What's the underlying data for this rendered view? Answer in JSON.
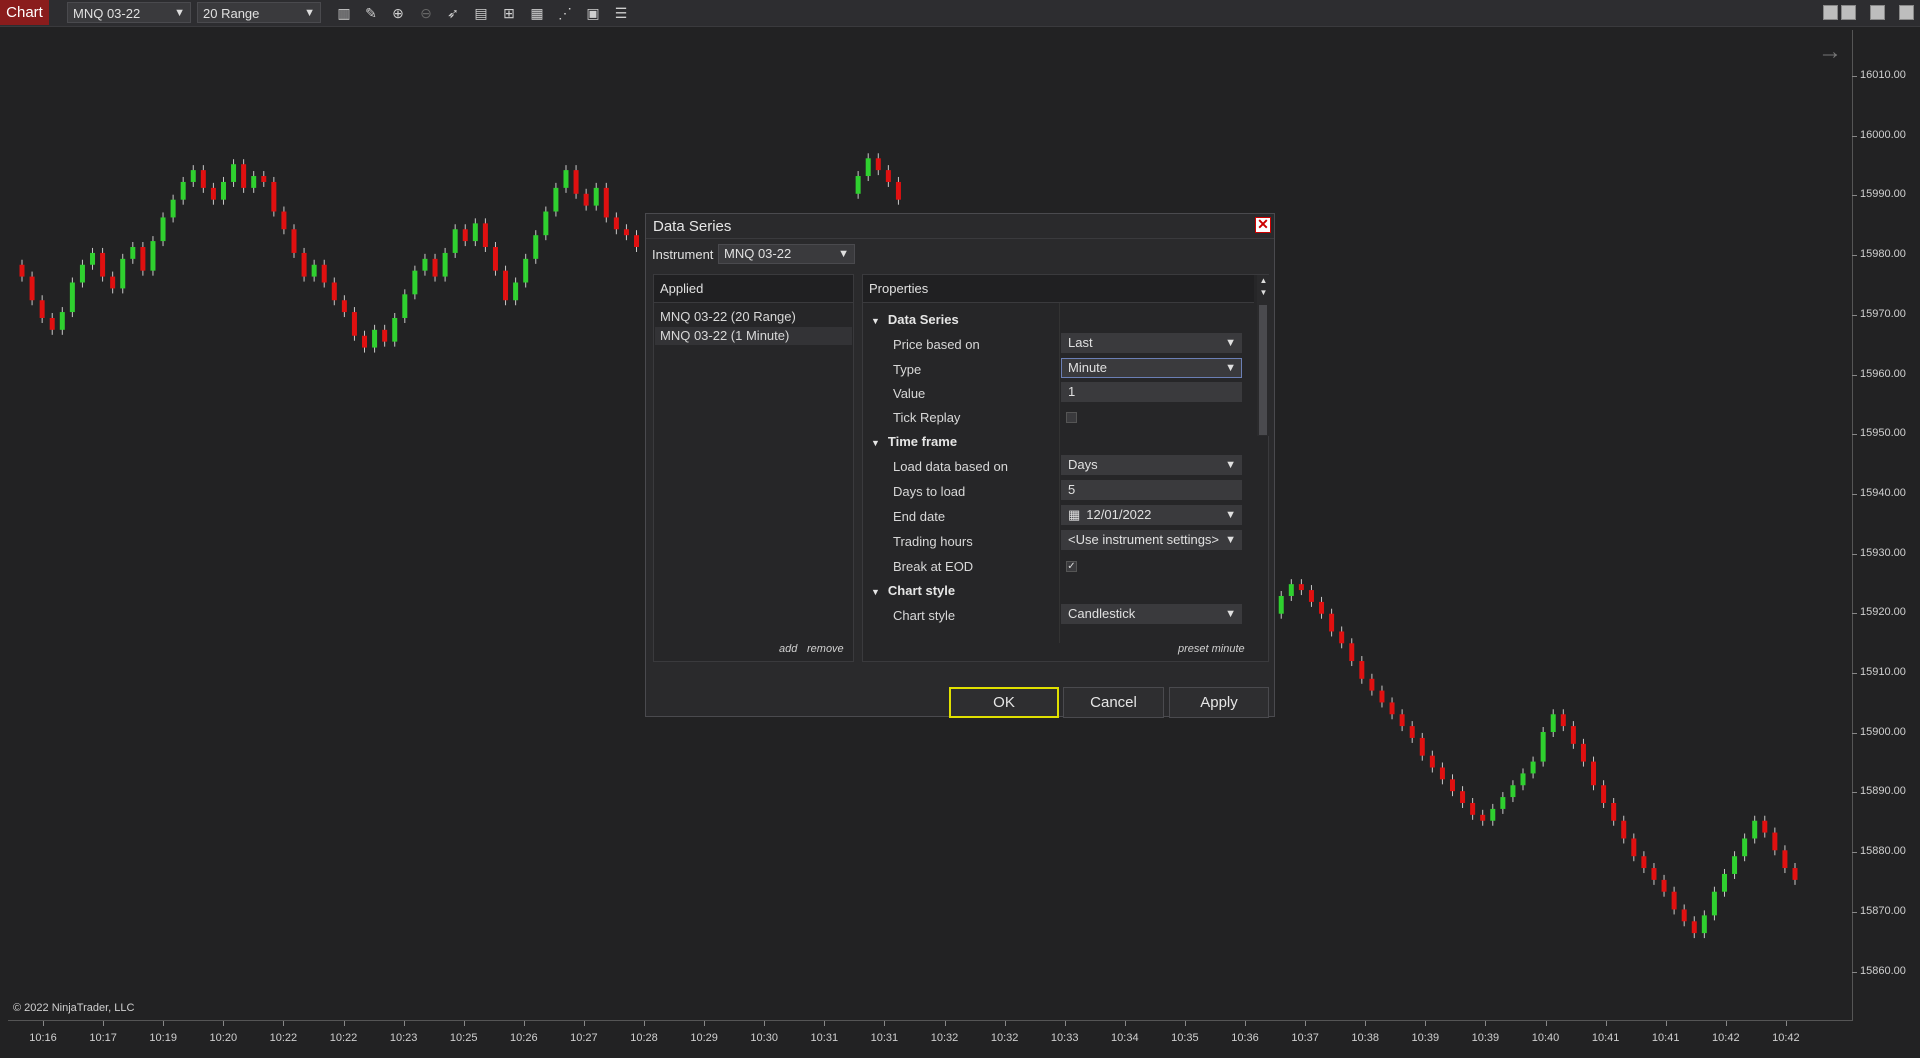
{
  "toolbar": {
    "chart_tab": "Chart",
    "instrument": "MNQ 03-22",
    "interval": "20 Range",
    "icons": [
      "bar-type-icon",
      "pencil-icon",
      "zoom-in-icon",
      "zoom-out-icon",
      "pointer-icon",
      "data-series-icon",
      "chart-style-icon",
      "indicators-icon",
      "strategies-icon",
      "templates-icon",
      "properties-icon"
    ]
  },
  "window_buttons": [
    "tile-icon",
    "minimize-icon",
    "maximize-icon",
    "close-icon"
  ],
  "chart": {
    "copyright": "© 2022 NinjaTrader, LLC",
    "y_labels": [
      "16010.00",
      "16000.00",
      "15990.00",
      "15980.00",
      "15970.00",
      "15960.00",
      "15950.00",
      "15940.00",
      "15930.00",
      "15920.00",
      "15910.00",
      "15900.00",
      "15890.00",
      "15880.00",
      "15870.00",
      "15860.00"
    ],
    "x_labels": [
      "10:16",
      "10:17",
      "10:19",
      "10:20",
      "10:22",
      "10:22",
      "10:23",
      "10:25",
      "10:26",
      "10:27",
      "10:28",
      "10:29",
      "10:30",
      "10:31",
      "10:31",
      "10:32",
      "10:32",
      "10:33",
      "10:34",
      "10:35",
      "10:36",
      "10:37",
      "10:38",
      "10:39",
      "10:39",
      "10:40",
      "10:41",
      "10:41",
      "10:42",
      "10:42"
    ],
    "colors": {
      "up": "#2fd02f",
      "down": "#e01010",
      "background": "#222223"
    }
  },
  "chart_data": {
    "type": "candlestick",
    "y_range": [
      15856,
      16020
    ],
    "closes": [
      15980,
      15976,
      15973,
      15971,
      15974,
      15979,
      15982,
      15984,
      15980,
      15978,
      15983,
      15985,
      15981,
      15986,
      15990,
      15993,
      15996,
      15998,
      15995,
      15993,
      15996,
      15999,
      15995,
      15997,
      15996,
      15991,
      15988,
      15984,
      15980,
      15982,
      15979,
      15976,
      15974,
      15970,
      15968,
      15971,
      15969,
      15973,
      15977,
      15981,
      15983,
      15980,
      15984,
      15988,
      15986,
      15989,
      15985,
      15981,
      15976,
      15979,
      15983,
      15987,
      15991,
      15995,
      15998,
      15994,
      15992,
      15995,
      15990,
      15988,
      15987,
      15985,
      15989,
      15986,
      15984,
      15985,
      15982,
      15980,
      15978,
      15982,
      15985,
      15983,
      15979,
      15975,
      15971,
      15968,
      15972,
      15976,
      15980,
      15984,
      15988,
      15991,
      15994,
      15997,
      16000,
      15998,
      15996,
      15993,
      15990,
      15988,
      15985,
      15982,
      15979,
      15976,
      15973,
      15970,
      15968,
      15966,
      15964,
      15962,
      15958,
      15955,
      15952,
      15949,
      15946,
      15943,
      15940,
      15938,
      15935,
      15933,
      15930,
      15928,
      15926,
      15925,
      15923,
      15924,
      15926,
      15928,
      15930,
      15929,
      15927,
      15925,
      15922,
      15921,
      15923,
      15926,
      15928,
      15927,
      15925,
      15923,
      15920,
      15918,
      15915,
      15912,
      15910,
      15908,
      15906,
      15904,
      15902,
      15899,
      15897,
      15895,
      15893,
      15891,
      15889,
      15888,
      15890,
      15892,
      15894,
      15896,
      15898,
      15903,
      15906,
      15904,
      15901,
      15898,
      15894,
      15891,
      15888,
      15885,
      15882,
      15880,
      15878,
      15876,
      15873,
      15871,
      15869,
      15872,
      15876,
      15879,
      15882,
      15885,
      15888,
      15886,
      15883,
      15880,
      15878
    ]
  },
  "dialog": {
    "title": "Data Series",
    "instrument_label": "Instrument",
    "instrument_value": "MNQ 03-22",
    "applied_header": "Applied",
    "applied_items": [
      "MNQ 03-22 (20 Range)",
      "MNQ 03-22 (1 Minute)"
    ],
    "add_label": "add",
    "remove_label": "remove",
    "properties_header": "Properties",
    "sections": {
      "data_series": "Data Series",
      "time_frame": "Time frame",
      "chart_style": "Chart style"
    },
    "props": {
      "price_based_on": {
        "label": "Price based on",
        "value": "Last"
      },
      "type": {
        "label": "Type",
        "value": "Minute"
      },
      "value": {
        "label": "Value",
        "value": "1"
      },
      "tick_replay": {
        "label": "Tick Replay",
        "checked": false
      },
      "load_data_based_on": {
        "label": "Load data based on",
        "value": "Days"
      },
      "days_to_load": {
        "label": "Days to load",
        "value": "5"
      },
      "end_date": {
        "label": "End date",
        "value": "12/01/2022"
      },
      "trading_hours": {
        "label": "Trading hours",
        "value": "<Use instrument settings>"
      },
      "break_at_eod": {
        "label": "Break at EOD",
        "checked": true
      },
      "chart_style": {
        "label": "Chart style",
        "value": "Candlestick"
      }
    },
    "preset_label": "preset minute",
    "ok_label": "OK",
    "cancel_label": "Cancel",
    "apply_label": "Apply"
  }
}
